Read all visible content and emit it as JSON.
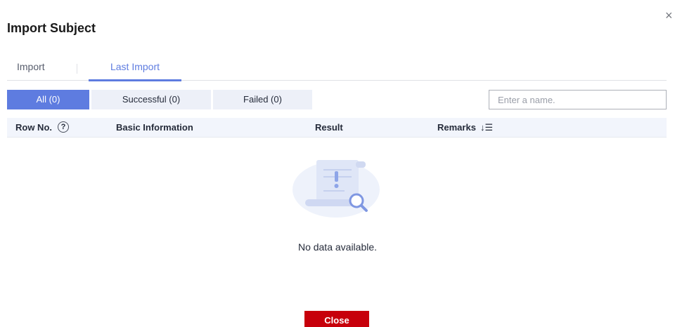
{
  "dialog": {
    "title": "Import Subject",
    "close_icon": "×"
  },
  "tabs": [
    {
      "label": "Import",
      "active": false
    },
    {
      "label": "Last Import",
      "active": true
    }
  ],
  "filters": [
    {
      "label": "All (0)",
      "active": true
    },
    {
      "label": "Successful (0)",
      "active": false
    },
    {
      "label": "Failed (0)",
      "active": false
    }
  ],
  "search": {
    "placeholder": "Enter a name.",
    "value": ""
  },
  "table": {
    "columns": [
      "Row No.",
      "Basic Information",
      "Result",
      "Remarks"
    ],
    "help_icon": "?",
    "sort_icon": "↓☰",
    "rows": []
  },
  "empty": {
    "message": "No data available."
  },
  "footer": {
    "close_label": "Close"
  },
  "colors": {
    "accent": "#5e7ce0",
    "danger": "#c7000b",
    "header_bg": "#f2f5fc"
  }
}
